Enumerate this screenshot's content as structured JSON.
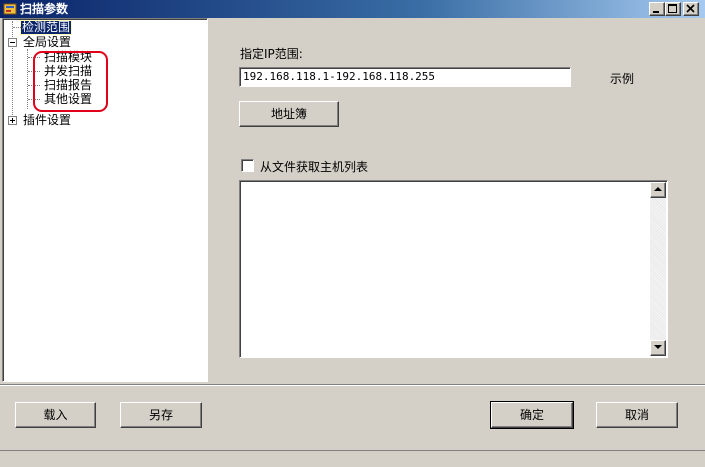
{
  "window": {
    "title": "扫描参数",
    "controls": {
      "minimize": "minimize-icon",
      "maximize": "maximize-icon",
      "close": "close-icon"
    }
  },
  "tree": {
    "items": [
      {
        "label": "检测范围",
        "selected": true
      },
      {
        "label": "全局设置",
        "expanded": true,
        "children": [
          "扫描模块",
          "并发扫描",
          "扫描报告",
          "其他设置"
        ]
      },
      {
        "label": "插件设置",
        "expanded": false
      }
    ],
    "highlight_color": "#e0001a"
  },
  "main": {
    "ip_label": "指定IP范围:",
    "ip_value": "192.168.118.1-192.168.118.255",
    "example_label": "示例",
    "address_book_button": "地址簿",
    "file_checkbox_label": "从文件获取主机列表",
    "file_checkbox_checked": false,
    "host_list_text": ""
  },
  "footer": {
    "load_button": "载入",
    "save_as_button": "另存",
    "ok_button": "确定",
    "cancel_button": "取消"
  },
  "colors": {
    "face": "#d4d0c8",
    "title_start": "#0a246a",
    "title_end": "#a6caf0",
    "selection": "#0a246a"
  }
}
